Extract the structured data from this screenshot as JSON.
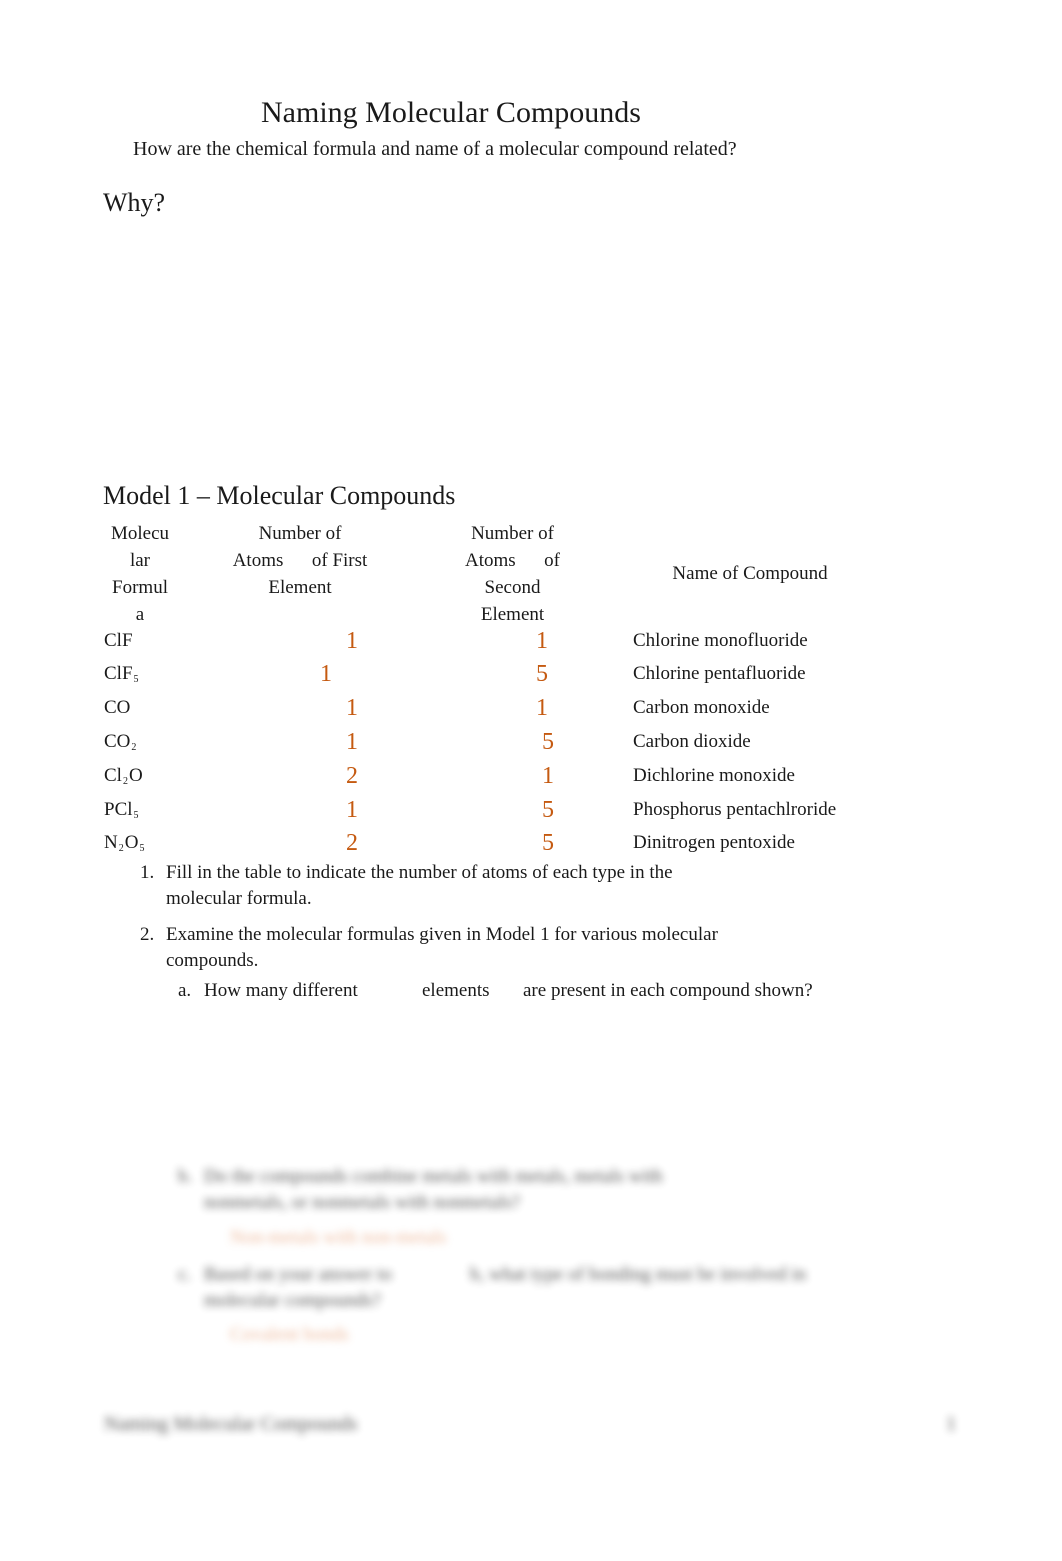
{
  "document": {
    "title": "Naming Molecular Compounds",
    "subtitle": "How are the chemical formula and name of a molecular compound related?",
    "why_heading": "Why?",
    "model_heading": "Model 1 – Molecular Compounds"
  },
  "table": {
    "headers": [
      "Molecu lar Formul a",
      "Number of\nAtoms      of First\nElement",
      "Number of\nAtoms      of\nSecond\nElement",
      "Name of Compound"
    ],
    "rows": [
      {
        "formula_parts": [
          "ClF",
          "",
          ""
        ],
        "first": "1",
        "second": "1",
        "name": "Chlorine monofluoride"
      },
      {
        "formula_parts": [
          "ClF",
          "5",
          ""
        ],
        "first": "1",
        "second": "5",
        "name": "Chlorine pentafluoride"
      },
      {
        "formula_parts": [
          "CO",
          "",
          ""
        ],
        "first": "1",
        "second": "1",
        "name": "Carbon monoxide"
      },
      {
        "formula_parts": [
          "CO",
          "2",
          ""
        ],
        "first": "1",
        "second": "5",
        "name": "Carbon dioxide"
      },
      {
        "formula_parts": [
          "Cl",
          "2",
          "O"
        ],
        "first": "2",
        "second": "1",
        "name": "Dichlorine monoxide"
      },
      {
        "formula_parts": [
          "PCl",
          "5",
          ""
        ],
        "first": "1",
        "second": "5",
        "name": "Phosphorus pentachlroride"
      },
      {
        "formula_parts": [
          "N",
          "2",
          "O",
          "5"
        ],
        "first": "2",
        "second": "5",
        "name": "Dinitrogen pentoxide"
      }
    ],
    "answer_color": "#c55a11"
  },
  "questions": [
    {
      "number": "1.",
      "line1": "Fill in the table to indicate the number of atoms of each type in the",
      "line2": "molecular formula."
    },
    {
      "number": "2.",
      "line1": "Examine the molecular formulas given in Model 1 for various molecular",
      "line2": "compounds."
    }
  ],
  "subquestion_a": {
    "letter": "a.",
    "part1": "How many different",
    "part2": "elements",
    "part3": "are present in each compound shown?"
  },
  "blurred": {
    "b_letter": "b.",
    "b_line1": "Do the compounds combine metals with metals, metals with",
    "b_line2": "nonmetals, or nonmetals with nonmetals?",
    "b_answer": "Non-metals with non-metals",
    "c_letter": "c.",
    "c_line1a": "Based on your answer to",
    "c_line1b": "b, what type of bonding must be involved in",
    "c_line2": "molecular compounds?",
    "c_answer": "Covalent bonds",
    "footer_left": "Naming Molecular Compounds",
    "footer_right": "1"
  }
}
